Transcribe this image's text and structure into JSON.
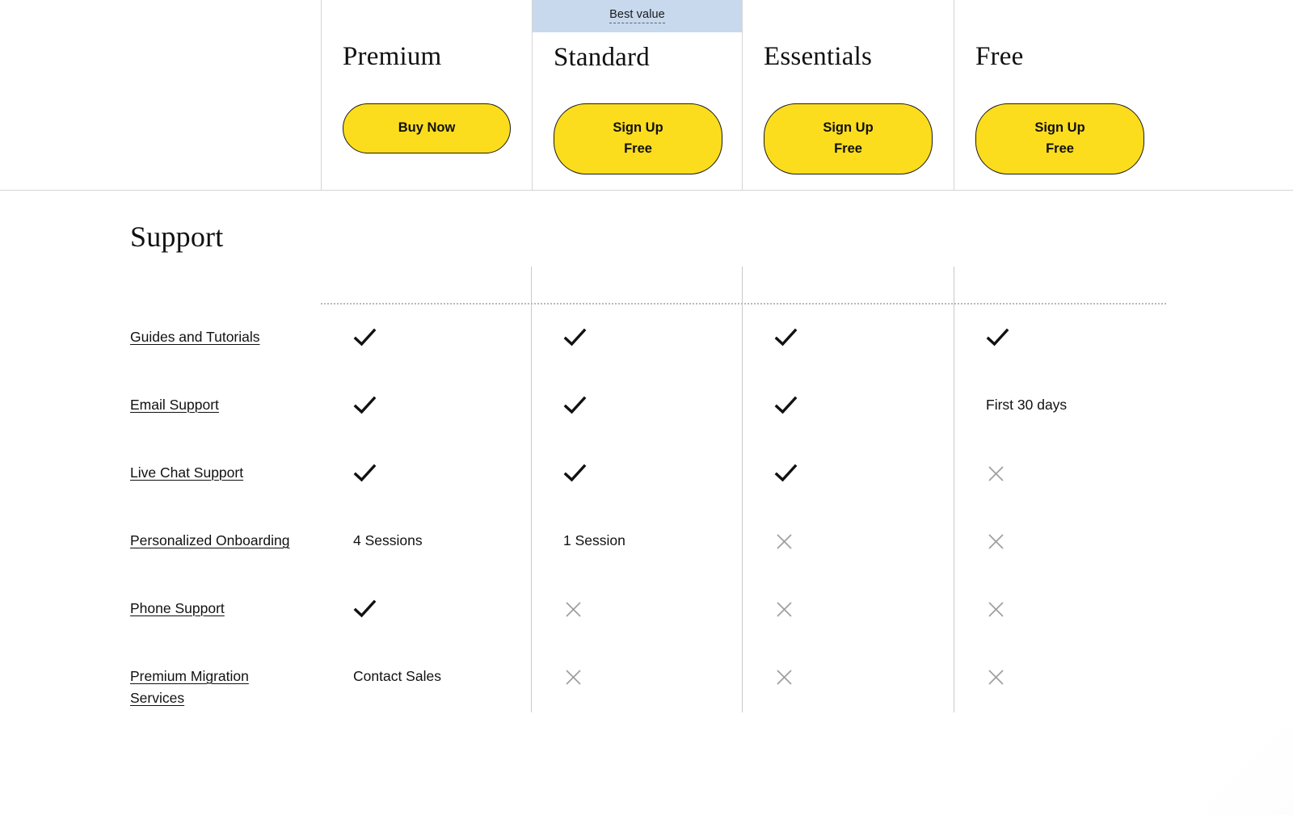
{
  "plans": {
    "badge_label": "Best value",
    "columns": [
      {
        "name": "",
        "cta": "",
        "badge": false
      },
      {
        "name": "Premium",
        "cta": "Buy Now",
        "badge": false
      },
      {
        "name": "Standard",
        "cta": "Sign Up\nFree",
        "badge": true
      },
      {
        "name": "Essentials",
        "cta": "Sign Up\nFree",
        "badge": false
      },
      {
        "name": "Free",
        "cta": "Sign Up\nFree",
        "badge": false
      }
    ]
  },
  "section": {
    "title": "Support"
  },
  "features": [
    {
      "label": "Guides and Tutorials",
      "values": [
        "check",
        "check",
        "check",
        "check"
      ]
    },
    {
      "label": "Email Support",
      "values": [
        "check",
        "check",
        "check",
        "First 30 days"
      ]
    },
    {
      "label": "Live Chat Support",
      "values": [
        "check",
        "check",
        "check",
        "cross"
      ]
    },
    {
      "label": "Personalized Onboarding",
      "values": [
        "4 Sessions",
        "1 Session",
        "cross",
        "cross"
      ]
    },
    {
      "label": "Phone Support",
      "values": [
        "check",
        "cross",
        "cross",
        "cross"
      ]
    },
    {
      "label": "Premium Migration Services",
      "values": [
        "Contact Sales",
        "cross",
        "cross",
        "cross"
      ]
    }
  ],
  "colors": {
    "cta_yellow": "#fcdd1e",
    "badge_blue": "#c8d9ee",
    "check_black": "#111111",
    "cross_gray": "#9e9e9e",
    "rule_gray": "#d4d4d4"
  }
}
